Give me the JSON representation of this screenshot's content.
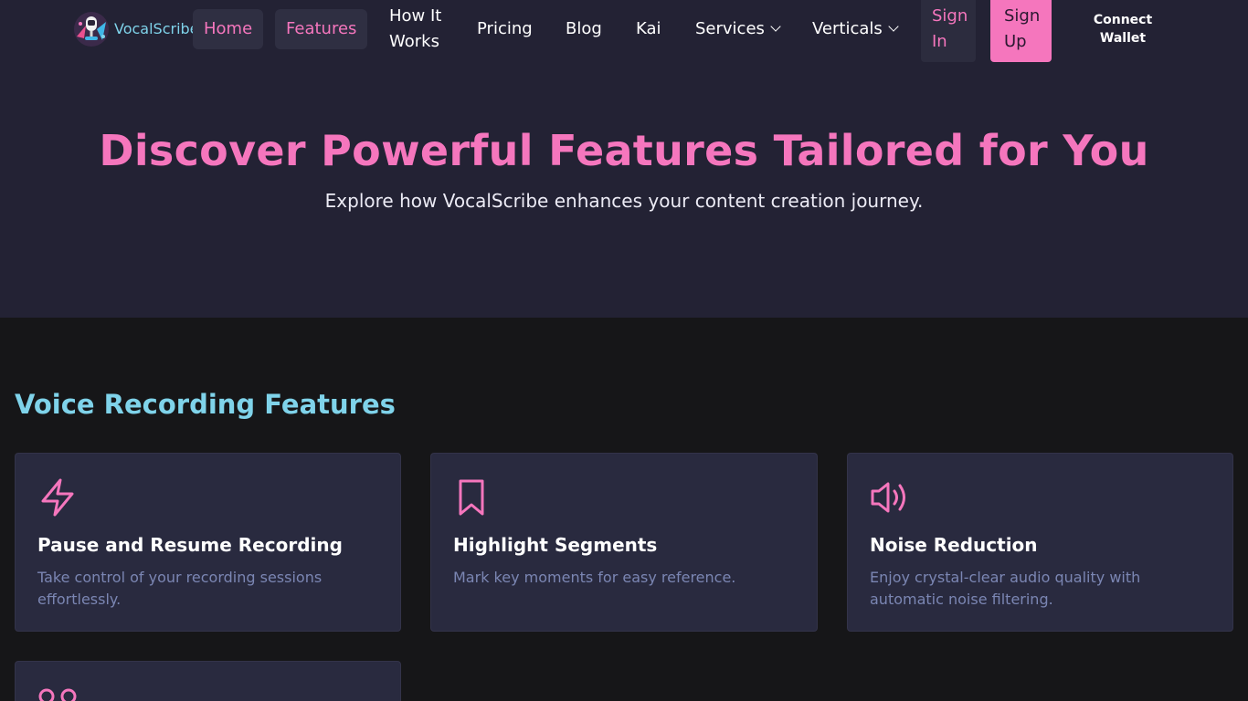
{
  "nav": {
    "brand": "VocalScribe",
    "items": {
      "home": "Home",
      "features": "Features",
      "how_it_works_1": "How It",
      "how_it_works_2": "Works",
      "pricing": "Pricing",
      "blog": "Blog",
      "kai": "Kai",
      "services": "Services",
      "verticals": "Verticals"
    },
    "sign_in_1": "Sign",
    "sign_in_2": "In",
    "sign_up_1": "Sign",
    "sign_up_2": "Up",
    "wallet_1": "Connect",
    "wallet_2": "Wallet"
  },
  "hero": {
    "title": "Discover Powerful Features Tailored for You",
    "subtitle": "Explore how VocalScribe enhances your content creation journey."
  },
  "section": {
    "title": "Voice Recording Features"
  },
  "features": [
    {
      "icon": "lightning-icon",
      "title": "Pause and Resume Recording",
      "desc": "Take control of your recording sessions effortlessly."
    },
    {
      "icon": "bookmark-icon",
      "title": "Highlight Segments",
      "desc": "Mark key moments for easy reference."
    },
    {
      "icon": "speaker-icon",
      "title": "Noise Reduction",
      "desc": "Enjoy crystal-clear audio quality with automatic noise filtering."
    },
    {
      "icon": "voicemail-icon"
    }
  ],
  "colors": {
    "accent_pink": "#f576bd",
    "accent_cyan": "#7fd3ea",
    "hero_bg": "#232234",
    "page_bg": "#161618",
    "card_bg": "#292a3f"
  }
}
